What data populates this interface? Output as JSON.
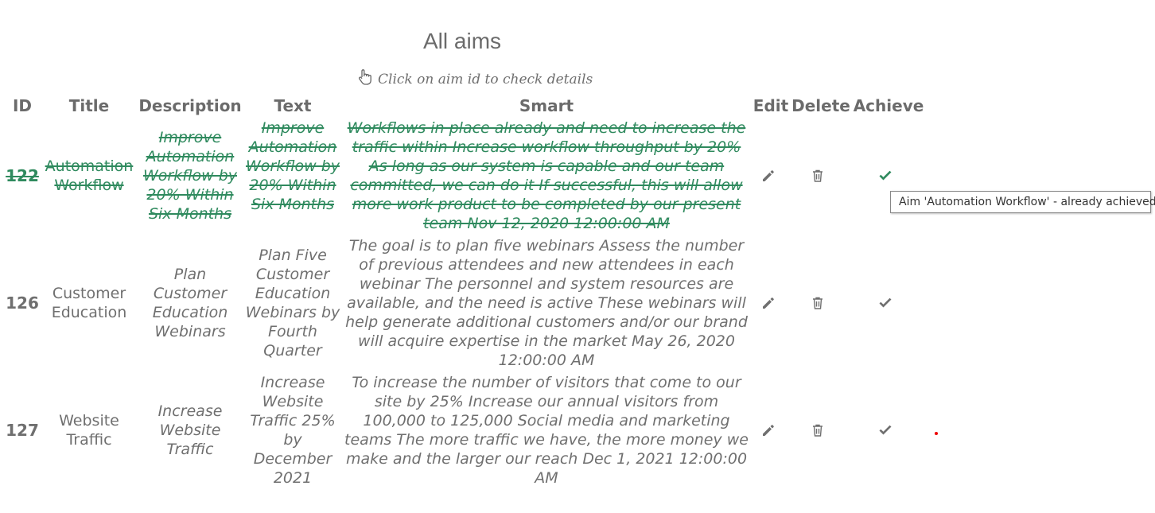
{
  "page": {
    "title": "All aims",
    "hint": "Click on aim id to check details"
  },
  "columns": [
    "ID",
    "Title",
    "Description",
    "Text",
    "Smart",
    "Edit",
    "Delete",
    "Achieve"
  ],
  "rows": [
    {
      "id": "122",
      "title": "Automation Workflow",
      "description": "Improve Automation Workflow by 20% Within Six Months",
      "text": "Improve Automation Workflow by 20% Within Six Months",
      "smart": "Workflows in place already and need to increase the traffic within Increase workflow throughput by 20% As long as our system is capable and our team committed, we can do it If successful, this will allow more work product to be completed by our present team Nov 12, 2020 12:00:00 AM",
      "achieved": true
    },
    {
      "id": "126",
      "title": "Customer Education",
      "description": "Plan Customer Education Webinars",
      "text": "Plan Five Customer Education Webinars by Fourth Quarter",
      "smart": "The goal is to plan five webinars Assess the number of previous attendees and new attendees in each webinar The personnel and system resources are available, and the need is active These webinars will help generate additional customers and/or our brand will acquire expertise in the market May 26, 2020 12:00:00 AM",
      "achieved": false
    },
    {
      "id": "127",
      "title": "Website Traffic",
      "description": "Increase Website Traffic",
      "text": "Increase Website Traffic 25% by December 2021",
      "smart": "To increase the number of visitors that come to our site by 25% Increase our annual visitors from 100,000 to 125,000 Social media and marketing teams The more traffic we have, the more money we make and the larger our reach Dec 1, 2021 12:00:00 AM",
      "achieved": false
    }
  ],
  "tooltip": "Aim 'Automation Workflow' - already achieved",
  "icons": {
    "hint": "pointing-hand-icon",
    "edit": "pencil-icon",
    "delete": "trash-icon",
    "achieve": "checkmark-icon"
  },
  "colors": {
    "achieved": "#2f8a5e",
    "text": "#6f6f6f"
  }
}
